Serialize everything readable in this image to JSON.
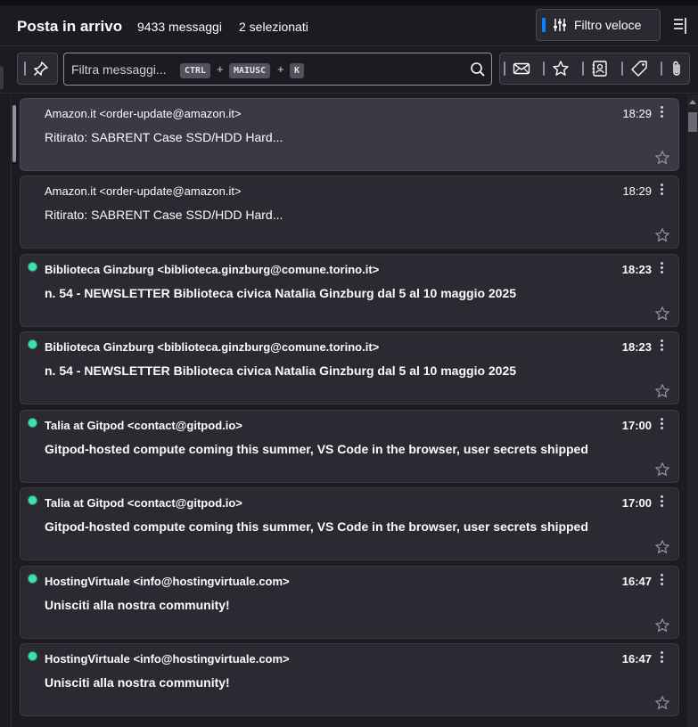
{
  "header": {
    "folder_title": "Posta in arrivo",
    "message_count": "9433 messaggi",
    "selected_count": "2 selezionati",
    "quick_filter_label": "Filtro veloce"
  },
  "filter": {
    "placeholder": "Filtra messaggi...",
    "shortcut_ctrl": "CTRL",
    "shortcut_shift": "MAIUSC",
    "shortcut_k": "K",
    "plus": "+"
  },
  "colors": {
    "accent": "#0a84ff",
    "unread_dot": "#3fe1b0",
    "background": "#1c1b22",
    "card": "#2b2a33"
  },
  "messages": [
    {
      "sender": "Amazon.it <order-update@amazon.it>",
      "time": "18:29",
      "subject": "Ritirato: SABRENT Case SSD/HDD Hard...",
      "unread": false,
      "selected": true
    },
    {
      "sender": "Amazon.it <order-update@amazon.it>",
      "time": "18:29",
      "subject": "Ritirato: SABRENT Case SSD/HDD Hard...",
      "unread": false,
      "selected": false
    },
    {
      "sender": "Biblioteca Ginzburg <biblioteca.ginzburg@comune.torino.it>",
      "time": "18:23",
      "subject": "n. 54 - NEWSLETTER Biblioteca civica Natalia Ginzburg dal 5 al 10 maggio 2025",
      "unread": true,
      "selected": false
    },
    {
      "sender": "Biblioteca Ginzburg <biblioteca.ginzburg@comune.torino.it>",
      "time": "18:23",
      "subject": "n. 54 - NEWSLETTER Biblioteca civica Natalia Ginzburg dal 5 al 10 maggio 2025",
      "unread": true,
      "selected": false
    },
    {
      "sender": "Talia at Gitpod <contact@gitpod.io>",
      "time": "17:00",
      "subject": "Gitpod-hosted compute coming this summer, VS Code in the browser, user secrets shipped",
      "unread": true,
      "selected": false
    },
    {
      "sender": "Talia at Gitpod <contact@gitpod.io>",
      "time": "17:00",
      "subject": "Gitpod-hosted compute coming this summer, VS Code in the browser, user secrets shipped",
      "unread": true,
      "selected": false
    },
    {
      "sender": "HostingVirtuale <info@hostingvirtuale.com>",
      "time": "16:47",
      "subject": "Unisciti alla nostra community!",
      "unread": true,
      "selected": false
    },
    {
      "sender": "HostingVirtuale <info@hostingvirtuale.com>",
      "time": "16:47",
      "subject": "Unisciti alla nostra community!",
      "unread": true,
      "selected": false
    }
  ]
}
